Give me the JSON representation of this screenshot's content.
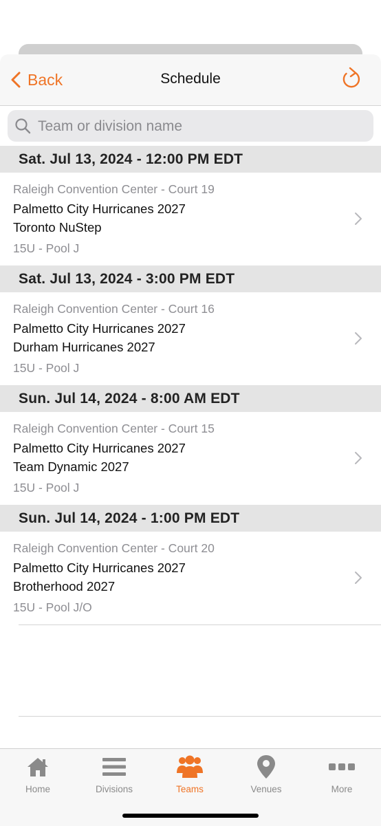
{
  "nav": {
    "back_label": "Back",
    "title": "Schedule"
  },
  "search": {
    "placeholder": "Team or division name",
    "value": ""
  },
  "schedule": [
    {
      "header": "Sat. Jul 13, 2024 - 12:00 PM EDT",
      "venue": "Raleigh Convention Center - Court 19",
      "team1": "Palmetto City Hurricanes 2027",
      "team2": "Toronto NuStep",
      "division": "15U - Pool J"
    },
    {
      "header": "Sat. Jul 13, 2024 - 3:00 PM EDT",
      "venue": "Raleigh Convention Center - Court 16",
      "team1": "Palmetto City Hurricanes 2027",
      "team2": "Durham Hurricanes 2027",
      "division": "15U - Pool J"
    },
    {
      "header": "Sun. Jul 14, 2024 - 8:00 AM EDT",
      "venue": "Raleigh Convention Center - Court 15",
      "team1": "Palmetto City Hurricanes 2027",
      "team2": "Team Dynamic 2027",
      "division": "15U - Pool J"
    },
    {
      "header": "Sun. Jul 14, 2024 - 1:00 PM EDT",
      "venue": "Raleigh Convention Center - Court 20",
      "team1": "Palmetto City Hurricanes 2027",
      "team2": "Brotherhood 2027",
      "division": "15U - Pool J/O"
    }
  ],
  "tabs": [
    {
      "label": "Home",
      "icon": "home-icon",
      "active": false
    },
    {
      "label": "Divisions",
      "icon": "list-icon",
      "active": false
    },
    {
      "label": "Teams",
      "icon": "people-icon",
      "active": true
    },
    {
      "label": "Venues",
      "icon": "location-pin-icon",
      "active": false
    },
    {
      "label": "More",
      "icon": "more-dots-icon",
      "active": false
    }
  ],
  "colors": {
    "accent": "#ef7426",
    "section_bg": "#e4e4e4",
    "secondary_text": "#8e8e93"
  }
}
